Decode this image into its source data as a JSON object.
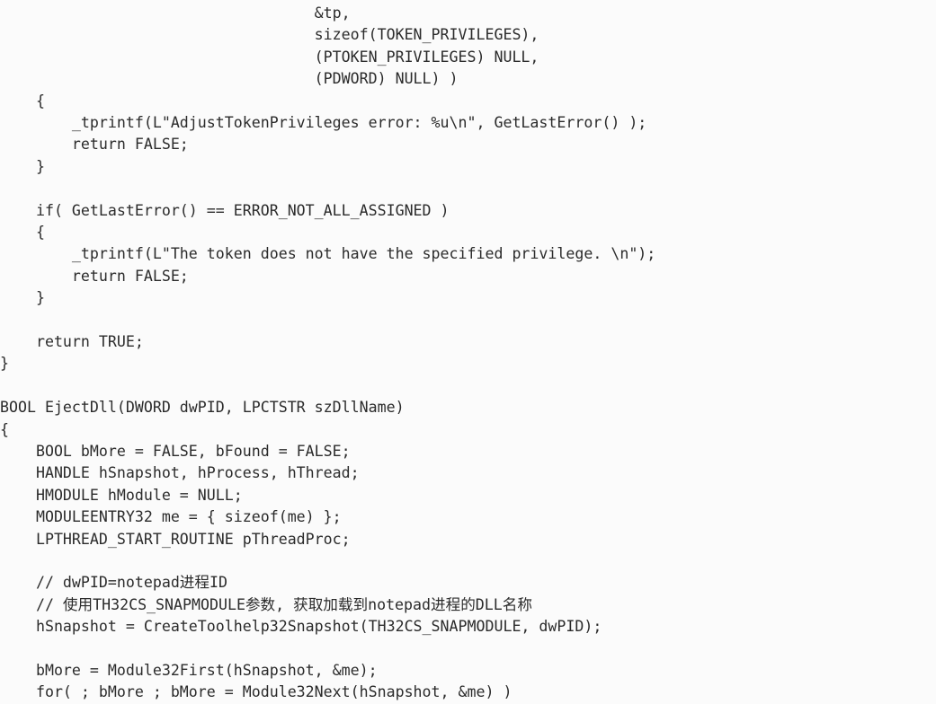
{
  "code": {
    "lines": [
      "                                   &tp,",
      "                                   sizeof(TOKEN_PRIVILEGES),",
      "                                   (PTOKEN_PRIVILEGES) NULL,",
      "                                   (PDWORD) NULL) )",
      "    {",
      "        _tprintf(L\"AdjustTokenPrivileges error: %u\\n\", GetLastError() );",
      "        return FALSE;",
      "    }",
      "",
      "    if( GetLastError() == ERROR_NOT_ALL_ASSIGNED )",
      "    {",
      "        _tprintf(L\"The token does not have the specified privilege. \\n\");",
      "        return FALSE;",
      "    }",
      "",
      "    return TRUE;",
      "}",
      "",
      "BOOL EjectDll(DWORD dwPID, LPCTSTR szDllName)",
      "{",
      "    BOOL bMore = FALSE, bFound = FALSE;",
      "    HANDLE hSnapshot, hProcess, hThread;",
      "    HMODULE hModule = NULL;",
      "    MODULEENTRY32 me = { sizeof(me) };",
      "    LPTHREAD_START_ROUTINE pThreadProc;",
      "",
      "    // dwPID=notepad进程ID",
      "    // 使用TH32CS_SNAPMODULE参数, 获取加载到notepad进程的DLL名称",
      "    hSnapshot = CreateToolhelp32Snapshot(TH32CS_SNAPMODULE, dwPID);",
      "",
      "    bMore = Module32First(hSnapshot, &me);",
      "    for( ; bMore ; bMore = Module32Next(hSnapshot, &me) )"
    ]
  }
}
